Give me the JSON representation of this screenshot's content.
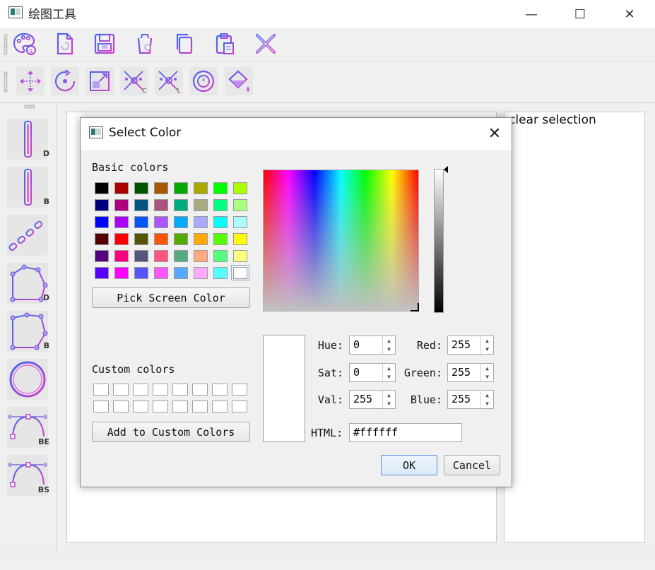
{
  "window": {
    "title": "绘图工具",
    "minimize": "—",
    "maximize": "☐",
    "close": "✕"
  },
  "toolbar1": {
    "icons": [
      "palette-icon",
      "new-file-icon",
      "save-icon",
      "clear-icon",
      "copy-icon",
      "paste-icon",
      "delete-icon"
    ]
  },
  "toolbar2": {
    "icons": [
      "move-icon",
      "rotate-icon",
      "scale-icon",
      "cut-c-icon",
      "cut-l-icon",
      "center-icon",
      "fill-icon"
    ]
  },
  "sidebar": {
    "tools": [
      {
        "name": "line-d-icon",
        "label": "D"
      },
      {
        "name": "line-b-icon",
        "label": "B"
      },
      {
        "name": "chain-icon",
        "label": ""
      },
      {
        "name": "polygon-d-icon",
        "label": "D"
      },
      {
        "name": "polygon-b-icon",
        "label": "B"
      },
      {
        "name": "circle-icon",
        "label": ""
      },
      {
        "name": "curve-be-icon",
        "label": "BE"
      },
      {
        "name": "curve-bs-icon",
        "label": "BS"
      }
    ]
  },
  "right_panel": {
    "text": "clear selection"
  },
  "dialog": {
    "title": "Select Color",
    "close": "✕",
    "basic_colors_label": "Basic colors",
    "basic_colors": [
      [
        "#000000",
        "#aa0000",
        "#005500",
        "#aa5500",
        "#00aa00",
        "#aaaa00",
        "#00ff00",
        "#aaff00"
      ],
      [
        "#00007f",
        "#aa007f",
        "#00557f",
        "#aa557f",
        "#00aa7f",
        "#aaaa7f",
        "#00ff7f",
        "#aaff7f"
      ],
      [
        "#0000ff",
        "#aa00ff",
        "#0055ff",
        "#aa55ff",
        "#00aaff",
        "#aaaaff",
        "#00ffff",
        "#aaffff"
      ],
      [
        "#550000",
        "#ff0000",
        "#555500",
        "#ff5500",
        "#55aa00",
        "#ffaa00",
        "#55ff00",
        "#ffff00"
      ],
      [
        "#55007f",
        "#ff007f",
        "#55557f",
        "#ff557f",
        "#55aa7f",
        "#ffaa7f",
        "#55ff7f",
        "#ffff7f"
      ],
      [
        "#5500ff",
        "#ff00ff",
        "#5555ff",
        "#ff55ff",
        "#55aaff",
        "#ffaaff",
        "#55ffff",
        "#ffffff"
      ]
    ],
    "pick_screen_color": "Pick Screen Color",
    "custom_colors_label": "Custom colors",
    "add_to_custom": "Add to Custom Colors",
    "hue_label": "Hue:",
    "hue": "0",
    "sat_label": "Sat:",
    "sat": "0",
    "val_label": "Val:",
    "val": "255",
    "red_label": "Red:",
    "red": "255",
    "green_label": "Green:",
    "green": "255",
    "blue_label": "Blue:",
    "blue": "255",
    "html_label": "HTML:",
    "html": "#ffffff",
    "ok": "OK",
    "cancel": "Cancel"
  }
}
